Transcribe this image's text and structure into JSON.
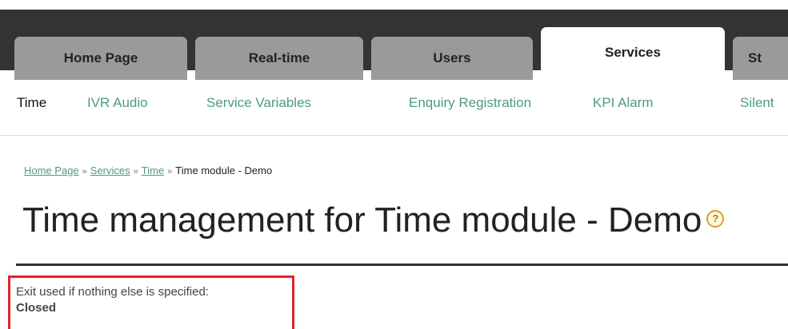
{
  "tabs": [
    {
      "label": "Home Page",
      "active": false
    },
    {
      "label": "Real-time",
      "active": false
    },
    {
      "label": "Users",
      "active": false
    },
    {
      "label": "Services",
      "active": true
    },
    {
      "label": "St",
      "active": false
    }
  ],
  "subnav": [
    {
      "label": "Time",
      "current": true
    },
    {
      "label": "IVR Audio",
      "current": false
    },
    {
      "label": "Service Variables",
      "current": false
    },
    {
      "label": "Enquiry Registration",
      "current": false
    },
    {
      "label": "KPI Alarm",
      "current": false
    },
    {
      "label": "Silent",
      "current": false
    }
  ],
  "breadcrumb": {
    "items": [
      "Home Page",
      "Services",
      "Time"
    ],
    "separator": "»",
    "current": "Time module - Demo"
  },
  "title": {
    "text": "Time management for Time module - Demo",
    "help_icon": "?"
  },
  "exit": {
    "label": "Exit used if nothing else is specified:",
    "value": "Closed"
  },
  "colors": {
    "tabbar_bg": "#333333",
    "tab_bg": "#9a9a9a",
    "link": "#4e9a84",
    "highlight_border": "#e3222a"
  }
}
